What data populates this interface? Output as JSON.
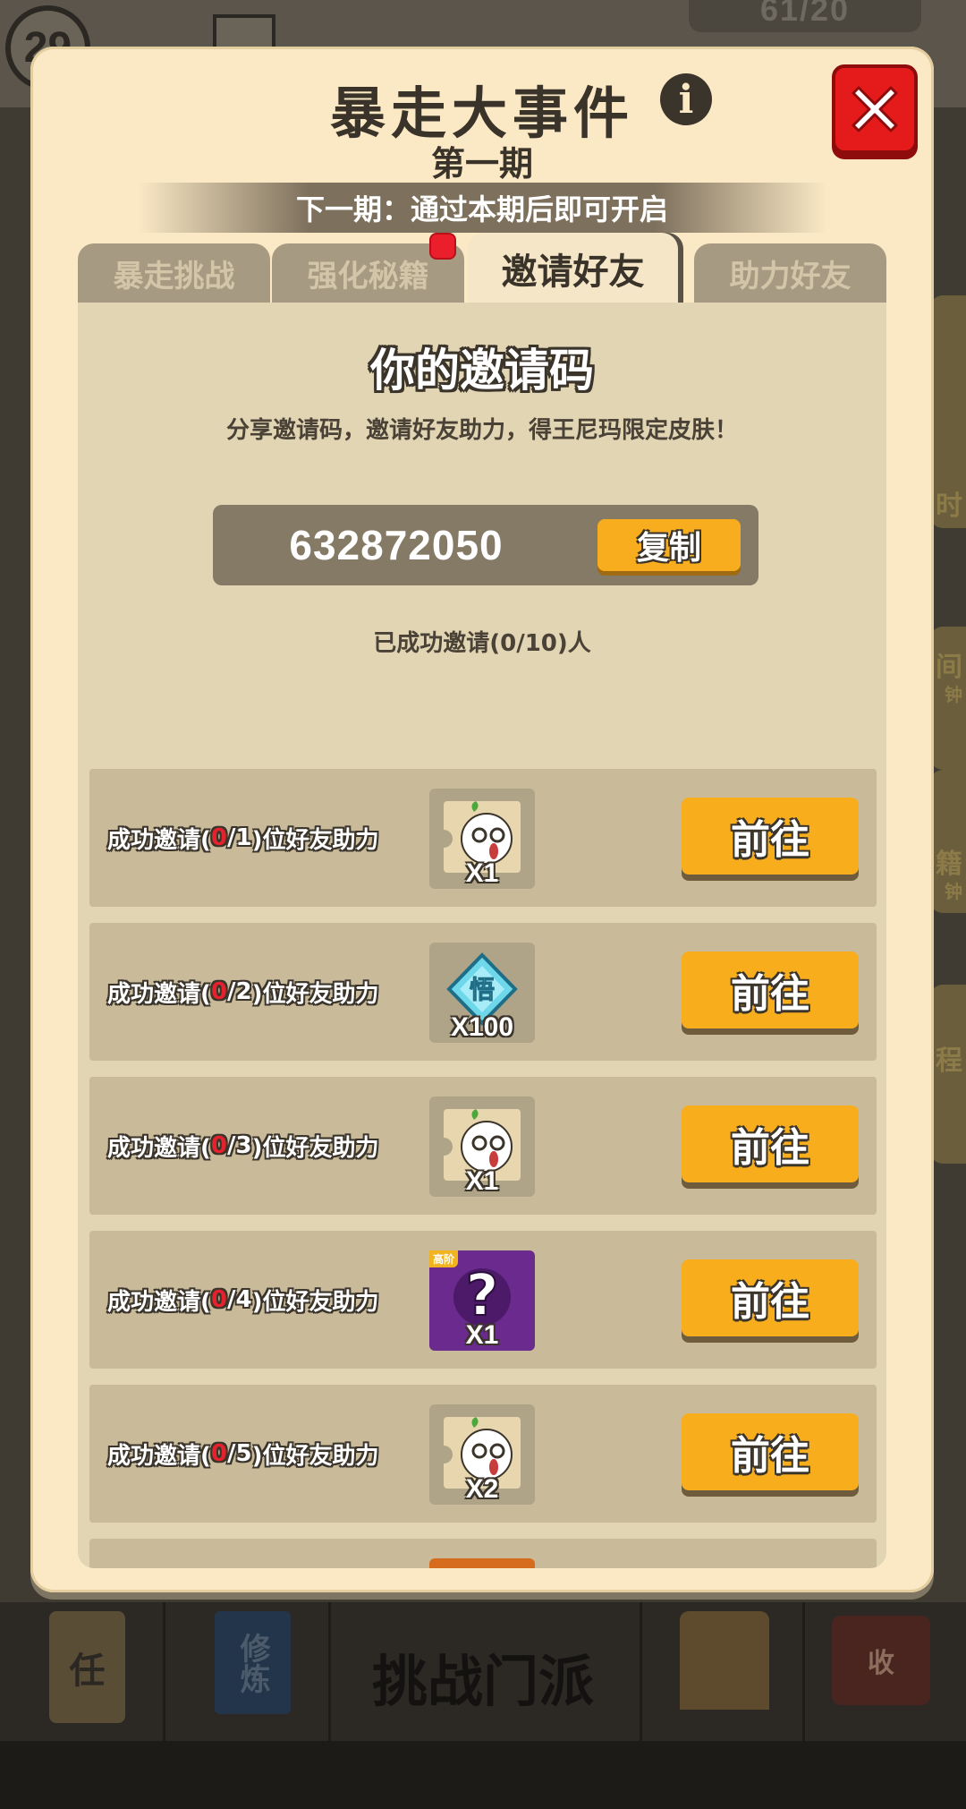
{
  "background": {
    "level": "29",
    "stamina": "61/20",
    "side_labels": [
      "时",
      "间",
      "钟",
      "籍",
      "钟",
      "程"
    ],
    "bottom_nav": [
      {
        "label": "任",
        "icon": "task-scroll-icon"
      },
      {
        "label": "修炼",
        "icon": "cultivation-book-icon"
      },
      {
        "label": "挑战门派",
        "icon": "challenge-sect-icon"
      },
      {
        "label": "",
        "icon": "tower-icon"
      },
      {
        "label": "收",
        "icon": "shop-icon"
      }
    ]
  },
  "modal": {
    "title": "暴走大事件",
    "subtitle": "第一期",
    "next_period": "下一期：通过本期后即可开启",
    "close_icon": "close-icon",
    "info_icon": "info-icon"
  },
  "tabs": [
    {
      "label": "暴走挑战",
      "active": false
    },
    {
      "label": "强化秘籍",
      "active": false,
      "has_dot": true
    },
    {
      "label": "邀请好友",
      "active": true
    },
    {
      "label": "助力好友",
      "active": false
    }
  ],
  "invite": {
    "heading": "你的邀请码",
    "description": "分享邀请码，邀请好友助力，得王尼玛限定皮肤！",
    "code": "632872050",
    "copy_label": "复制",
    "success_count": "已成功邀请(0/10)人"
  },
  "rewards": [
    {
      "prefix": "成功邀请(",
      "current": "0",
      "target": "/1",
      "suffix": ")位好友助力",
      "icon": "wang-nima-head-icon",
      "qty": "X1",
      "button": "前往"
    },
    {
      "prefix": "成功邀请(",
      "current": "0",
      "target": "/2",
      "suffix": ")位好友助力",
      "icon": "diamond-gem-icon",
      "gem_label": "悟",
      "qty": "X100",
      "button": "前往"
    },
    {
      "prefix": "成功邀请(",
      "current": "0",
      "target": "/3",
      "suffix": ")位好友助力",
      "icon": "wang-nima-head-icon",
      "qty": "X1",
      "button": "前往"
    },
    {
      "prefix": "成功邀请(",
      "current": "0",
      "target": "/4",
      "suffix": ")位好友助力",
      "icon": "mystery-question-icon",
      "tag": "高阶",
      "qty": "X1",
      "button": "前往"
    },
    {
      "prefix": "成功邀请(",
      "current": "0",
      "target": "/5",
      "suffix": ")位好友助力",
      "icon": "wang-nima-head-icon",
      "qty": "X2",
      "button": "前往"
    }
  ],
  "colors": {
    "modal_bg": "#fbe9c5",
    "panel_bg": "#e2d5b3",
    "row_bg": "#c9bb9a",
    "button_orange": "#f8ad1d",
    "close_red": "#e51b1b",
    "highlight_red": "#e5212e"
  }
}
